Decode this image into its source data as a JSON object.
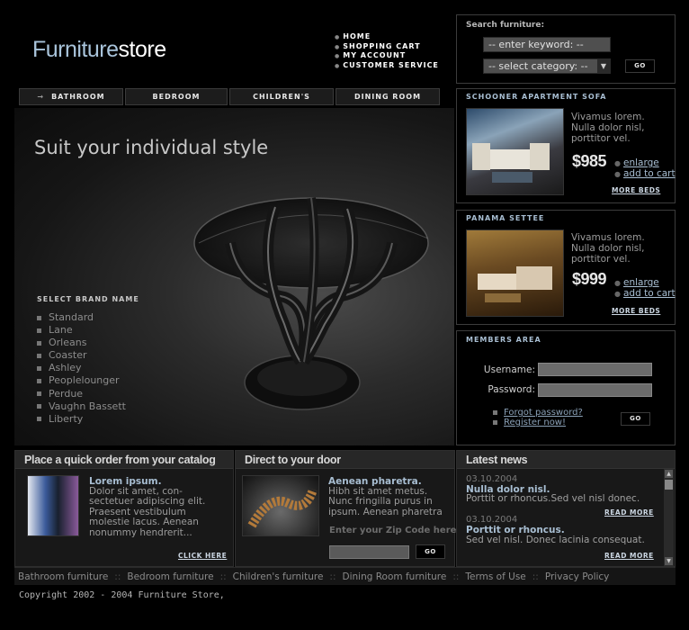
{
  "logo": {
    "part1": "Furniture",
    "part2": "store"
  },
  "top_nav": [
    "HOME",
    "SHOPPING CART",
    "MY ACCOUNT",
    "CUSTOMER SERVICE"
  ],
  "tabs": [
    "BATHROOM",
    "BEDROOM",
    "CHILDREN'S",
    "DINING ROOM"
  ],
  "hero": {
    "title": "Suit your individual style",
    "brand_title": "SELECT BRAND NAME",
    "brands": [
      "Standard",
      "Lane",
      "Orleans",
      "Coaster",
      "Ashley",
      "Peoplelounger",
      "Perdue",
      "Vaughn Bassett",
      "Liberty"
    ]
  },
  "search": {
    "title": "Search furniture:",
    "keyword_placeholder": "-- enter keyword: --",
    "category_value": "-- select category: --",
    "go_label": "GO"
  },
  "products": [
    {
      "title": "SCHOONER APARTMENT SOFA",
      "text": [
        "Vivamus lorem.",
        "Nulla dolor nisl,",
        "porttitor vel."
      ],
      "price": "$985",
      "enlarge": "enlarge",
      "add_to_cart": "add to cart",
      "more": "MORE BEDS"
    },
    {
      "title": "PANAMA SETTEE",
      "text": [
        "Vivamus lorem.",
        "Nulla dolor nisl,",
        "porttitor vel."
      ],
      "price": "$999",
      "enlarge": "enlarge",
      "add_to_cart": "add to cart",
      "more": "MORE BEDS"
    }
  ],
  "members": {
    "title": "MEMBERS AREA",
    "username_label": "Username:",
    "password_label": "Password:",
    "forgot": "Forgot password?",
    "register": "Register now!",
    "go_label": "GO"
  },
  "catalog": {
    "heading": "Place a quick order from your catalog",
    "title": "Lorem ipsum.",
    "lines": [
      "Dolor sit amet, con-",
      "sectetuer adipiscing elit.",
      "Praesent vestibulum",
      "molestie lacus. Aenean",
      "nonummy hendrerit..."
    ],
    "link": "CLICK HERE"
  },
  "door": {
    "heading": "Direct to your door",
    "title": "Aenean pharetra.",
    "lines": [
      "Hibh sit amet metus.",
      "Nunc fringilla purus in",
      "ipsum. Aenean pharetra"
    ],
    "zip_label": "Enter your Zip Code here",
    "go_label": "GO"
  },
  "news": {
    "heading": "Latest news",
    "items": [
      {
        "date": "03.10.2004",
        "title": "Nulla dolor nisl.",
        "text": "Porttit or rhoncus.Sed vel nisl donec.",
        "more": "READ MORE"
      },
      {
        "date": "03.10.2004",
        "title": "Porttit or rhoncus.",
        "text": "Sed vel nisl. Donec lacinia consequat.",
        "more": "READ MORE"
      }
    ]
  },
  "footer": {
    "links": [
      "Bathroom furniture",
      "Bedroom furniture",
      "Children's furniture",
      "Dining Room furniture",
      "Terms of Use",
      "Privacy Policy"
    ],
    "separator": "::",
    "copyright": "Copyright 2002 - 2004 Furniture Store,"
  }
}
